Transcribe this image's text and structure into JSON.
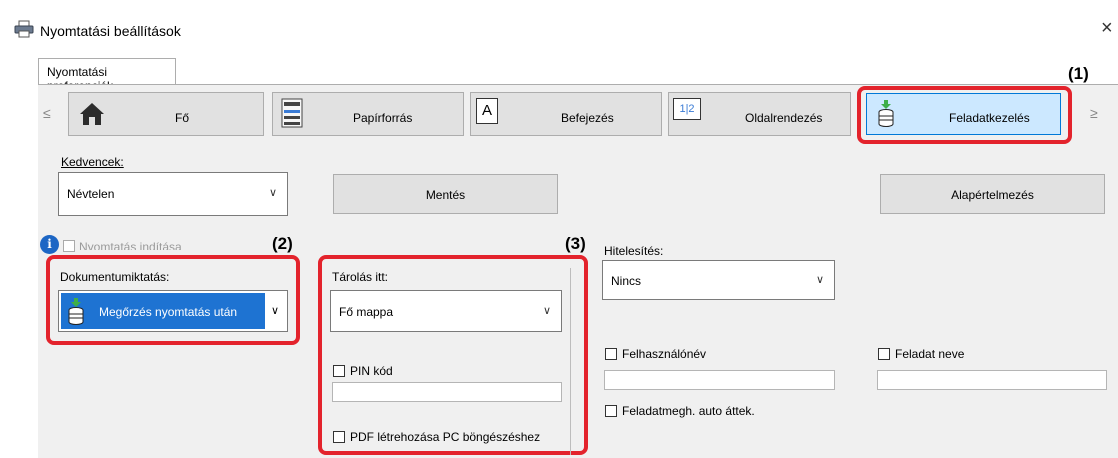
{
  "window": {
    "title": "Nyomtatási beállítások",
    "close": "×"
  },
  "tabs": [
    {
      "label": "Nyomtatási preferenciák"
    }
  ],
  "nav": {
    "prev": "≤",
    "next": "≥",
    "items": [
      {
        "label": "Fő",
        "icon": "home-icon"
      },
      {
        "label": "Papírforrás",
        "icon": "paper-tray-icon"
      },
      {
        "label": "Befejezés",
        "icon": "finishing-icon",
        "glyph": "A"
      },
      {
        "label": "Oldalrendezés",
        "icon": "layout-icon",
        "glyph": "1|2"
      },
      {
        "label": "Feladatkezelés",
        "icon": "job-handling-icon"
      }
    ]
  },
  "callouts": {
    "c1": "(1)",
    "c2": "(2)",
    "c3": "(3)"
  },
  "favorites": {
    "label": "Kedvencek:",
    "value": "Névtelen",
    "save": "Mentés",
    "defaults": "Alapértelmezés"
  },
  "print_start": {
    "label": "Nyomtatás indítása"
  },
  "retention": {
    "label": "Dokumentumiktatás:",
    "value": "Megőrzés nyomtatás után"
  },
  "store": {
    "label": "Tárolás itt:",
    "value": "Fő mappa",
    "pin_label": "PIN kód",
    "pdf_label": "PDF létrehozása PC böngészéshez"
  },
  "auth": {
    "label": "Hitelesítés:",
    "value": "Nincs",
    "username_label": "Felhasználónév",
    "jobname_label": "Feladat neve",
    "auto_label": "Feladatmegh. auto áttek."
  },
  "colors": {
    "accent_red": "#e3232c",
    "selected_blue": "#cce8ff",
    "retention_blue": "#1e73d2"
  }
}
